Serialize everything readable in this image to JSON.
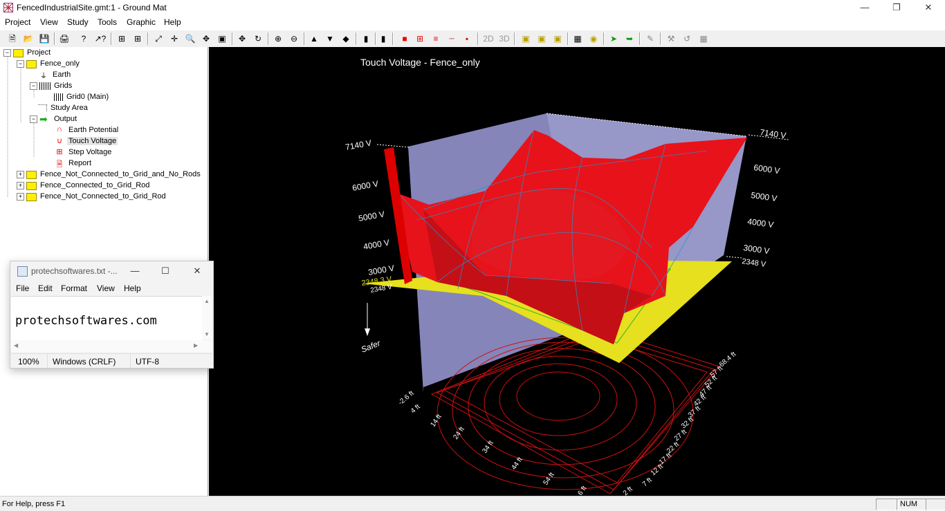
{
  "window": {
    "title": "FencedIndustrialSite.gmt:1 - Ground Mat"
  },
  "menu": [
    "Project",
    "View",
    "Study",
    "Tools",
    "Graphic",
    "Help"
  ],
  "tree": [
    {
      "label": "Project",
      "level": 0,
      "exp": "⊟",
      "icon": "folder"
    },
    {
      "label": "Fence_only",
      "level": 1,
      "exp": "⊟",
      "icon": "folder"
    },
    {
      "label": "Earth",
      "level": 2,
      "exp": "",
      "icon": "earth"
    },
    {
      "label": "Grids",
      "level": 2,
      "exp": "⊟",
      "icon": "grids"
    },
    {
      "label": "Grid0 (Main)",
      "level": 3,
      "exp": "",
      "icon": "grids"
    },
    {
      "label": "Study Area",
      "level": 2,
      "exp": "",
      "icon": "area"
    },
    {
      "label": "Output",
      "level": 2,
      "exp": "⊟",
      "icon": "arrow"
    },
    {
      "label": "Earth Potential",
      "level": 3,
      "exp": "",
      "icon": "wave"
    },
    {
      "label": "Touch Voltage",
      "level": 3,
      "exp": "",
      "icon": "wave2",
      "selected": true
    },
    {
      "label": "Step Voltage",
      "level": 3,
      "exp": "",
      "icon": "step"
    },
    {
      "label": "Report",
      "level": 3,
      "exp": "",
      "icon": "report"
    },
    {
      "label": "Fence_Not_Connected_to_Grid_and_No_Rods",
      "level": 1,
      "exp": "⊞",
      "icon": "folder"
    },
    {
      "label": "Fence_Connected_to_Grid_Rod",
      "level": 1,
      "exp": "⊞",
      "icon": "folder"
    },
    {
      "label": "Fence_Not_Connected_to_Grid_Rod",
      "level": 1,
      "exp": "⊞",
      "icon": "folder"
    }
  ],
  "plot": {
    "title": "Touch Voltage - Fence_only",
    "left_axis": [
      "7140 V",
      "6000 V",
      "5000 V",
      "4000 V",
      "3000 V",
      "2348 V"
    ],
    "right_axis": [
      "7140 V",
      "6000 V",
      "5000 V",
      "4000 V",
      "3000 V",
      "2348 V"
    ],
    "threshold_label": "2348.3 V",
    "safer_label": "Safer",
    "x_ticks": [
      "-2.6 ft",
      "4 ft",
      "14 ft",
      "24 ft",
      "34 ft",
      "44 ft",
      "54 ft",
      "6 ft"
    ],
    "y_ticks": [
      "68.4 ft",
      "57 ft",
      "52 ft",
      "47 ft",
      "42 ft",
      "37 ft",
      "32 ft",
      "27 ft",
      "22 ft",
      "17 ft",
      "12 ft",
      "7 ft",
      "2 ft"
    ],
    "colors": {
      "surface": "#e8121b",
      "mesh": "#2a8fc7",
      "wall": "#8f8fc4",
      "plane": "#e6e01e"
    }
  },
  "notepad": {
    "title": "protechsoftwares.txt -...",
    "menu": [
      "File",
      "Edit",
      "Format",
      "View",
      "Help"
    ],
    "content": "protechsoftwares.com",
    "status": {
      "zoom": "100%",
      "eol": "Windows (CRLF)",
      "encoding": "UTF-8"
    }
  },
  "status": {
    "help": "For Help, press F1",
    "num": "NUM"
  }
}
